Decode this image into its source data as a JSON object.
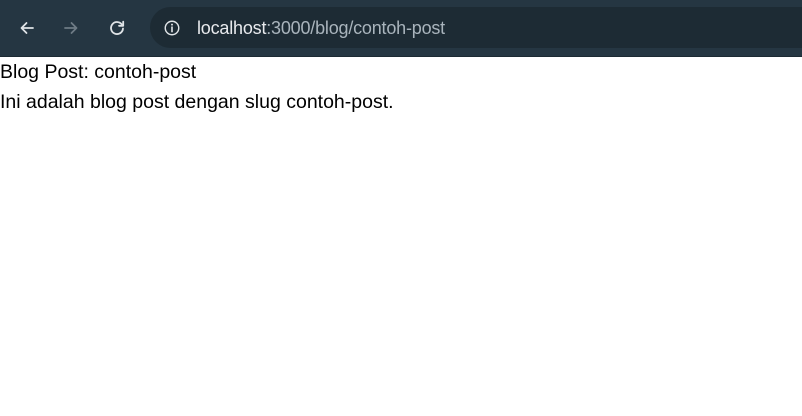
{
  "browser": {
    "url_host": "localhost",
    "url_path": ":3000/blog/contoh-post",
    "icons": {
      "back": "arrow-left-icon",
      "forward": "arrow-right-icon",
      "reload": "reload-icon",
      "site_info": "info-circle-icon"
    },
    "colors": {
      "toolbar": "#253642",
      "omnibox": "#1d2b34"
    }
  },
  "page": {
    "title": "Blog Post: contoh-post",
    "body": "Ini adalah blog post dengan slug contoh-post."
  }
}
